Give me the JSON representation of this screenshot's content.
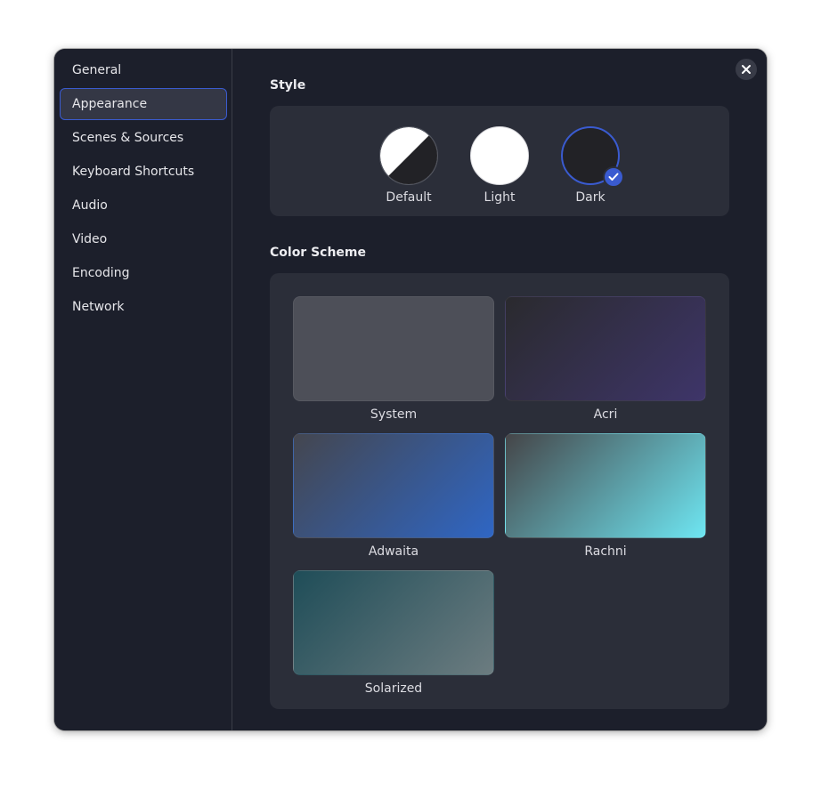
{
  "sidebar": {
    "items": [
      {
        "label": "General"
      },
      {
        "label": "Appearance",
        "active": true
      },
      {
        "label": "Scenes & Sources"
      },
      {
        "label": "Keyboard Shortcuts"
      },
      {
        "label": "Audio"
      },
      {
        "label": "Video"
      },
      {
        "label": "Encoding"
      },
      {
        "label": "Network"
      }
    ]
  },
  "close": {
    "icon": "close-icon"
  },
  "style_section": {
    "title": "Style",
    "options": [
      {
        "label": "Default",
        "selected": false
      },
      {
        "label": "Light",
        "selected": false
      },
      {
        "label": "Dark",
        "selected": true
      }
    ],
    "selected_icon": "checkmark-icon"
  },
  "color_scheme_section": {
    "title": "Color Scheme",
    "schemes": [
      {
        "label": "System",
        "colors": [
          "#4d4f58",
          "#4d4f58"
        ]
      },
      {
        "label": "Acri",
        "colors": [
          "#2a2a2e",
          "#3e3569"
        ]
      },
      {
        "label": "Adwaita",
        "colors": [
          "#44464f",
          "#2f66c4"
        ]
      },
      {
        "label": "Rachni",
        "colors": [
          "#454548",
          "#6ee6f2"
        ]
      },
      {
        "label": "Solarized",
        "colors": [
          "#1f4d58",
          "#6c7c80"
        ]
      }
    ]
  },
  "colors": {
    "accent": "#3a5bd0",
    "window_bg": "#1c1f2b",
    "card_bg": "#2b2e39"
  }
}
